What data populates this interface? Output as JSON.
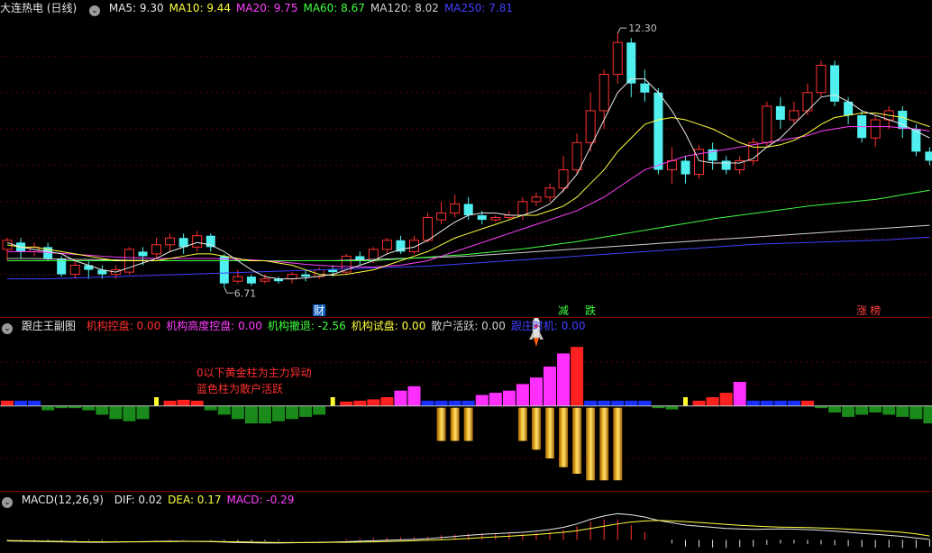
{
  "main": {
    "title": "大连热电 (日线)",
    "indicators": [
      {
        "label": "MA5:",
        "value": "9.30",
        "color": "#e8e8e8"
      },
      {
        "label": "MA10:",
        "value": "9.44",
        "color": "#ffff40"
      },
      {
        "label": "MA20:",
        "value": "9.75",
        "color": "#ff40ff"
      },
      {
        "label": "MA60:",
        "value": "8.67",
        "color": "#40ff40"
      },
      {
        "label": "MA120:",
        "value": "8.02",
        "color": "#d0d0d0"
      },
      {
        "label": "MA250:",
        "value": "7.81",
        "color": "#4040ff"
      }
    ],
    "high_label": "12.30",
    "low_label": "6.71",
    "markers": [
      {
        "text": "财",
        "index": 23,
        "color": "#ffffff",
        "bg": "#1060c0"
      },
      {
        "text": "减",
        "index": 41,
        "color": "#40ff40",
        "bg": ""
      },
      {
        "text": "跌",
        "index": 43,
        "color": "#40ff40",
        "bg": ""
      },
      {
        "text": "涨",
        "index": 63,
        "color": "#ff4040",
        "bg": ""
      },
      {
        "text": "榜",
        "index": 64,
        "color": "#ff4040",
        "bg": ""
      }
    ]
  },
  "sub1": {
    "title": "跟庄王副图",
    "indicators": [
      {
        "label": "机构控盘:",
        "value": "0.00",
        "color": "#ff3030"
      },
      {
        "label": "机构高度控盘:",
        "value": "0.00",
        "color": "#ff40ff"
      },
      {
        "label": "机构撤退:",
        "value": "-2.56",
        "color": "#40ff40"
      },
      {
        "label": "机构试盘:",
        "value": "0.00",
        "color": "#ffff40"
      },
      {
        "label": "散户活跃:",
        "value": "0.00",
        "color": "#d0d0d0"
      },
      {
        "label": "跟庄时机:",
        "value": "0.00",
        "color": "#4040ff"
      }
    ],
    "note_line1": "0以下黄金柱为主力异动",
    "note_line2": "蓝色柱为散户活跃"
  },
  "sub2": {
    "title": "MACD(12,26,9)",
    "indicators": [
      {
        "label": "DIF:",
        "value": "0.02",
        "color": "#e8e8e8"
      },
      {
        "label": "DEA:",
        "value": "0.17",
        "color": "#ffff40"
      },
      {
        "label": "MACD:",
        "value": "-0.29",
        "color": "#ff40ff"
      }
    ]
  },
  "colors": {
    "up": "#ff3030",
    "down": "#50f0f0",
    "ma5": "#e8e8e8",
    "ma10": "#ffff40",
    "ma20": "#ff40ff",
    "ma60": "#40ff40",
    "ma120": "#d0d0d0",
    "ma250": "#4040ff"
  },
  "chart_data": {
    "type": "candlestick",
    "y_range": [
      6.2,
      12.6
    ],
    "candles": [
      [
        7.55,
        7.75,
        7.3,
        7.8
      ],
      [
        7.7,
        7.5,
        7.35,
        7.8
      ],
      [
        7.5,
        7.6,
        7.4,
        7.7
      ],
      [
        7.6,
        7.35,
        7.3,
        7.7
      ],
      [
        7.35,
        7.0,
        6.95,
        7.4
      ],
      [
        7.0,
        7.2,
        6.9,
        7.3
      ],
      [
        7.2,
        7.1,
        6.9,
        7.3
      ],
      [
        7.1,
        7.0,
        6.9,
        7.2
      ],
      [
        7.0,
        7.1,
        6.9,
        7.2
      ],
      [
        7.05,
        7.55,
        7.0,
        7.6
      ],
      [
        7.5,
        7.4,
        7.2,
        7.6
      ],
      [
        7.45,
        7.65,
        7.35,
        7.8
      ],
      [
        7.65,
        7.8,
        7.5,
        7.9
      ],
      [
        7.8,
        7.6,
        7.45,
        7.9
      ],
      [
        7.6,
        7.85,
        7.5,
        7.95
      ],
      [
        7.85,
        7.6,
        7.5,
        7.9
      ],
      [
        7.4,
        6.8,
        6.71,
        7.45
      ],
      [
        6.85,
        6.95,
        6.8,
        7.1
      ],
      [
        6.95,
        6.8,
        6.75,
        7.0
      ],
      [
        6.85,
        6.9,
        6.8,
        7.0
      ],
      [
        6.9,
        6.85,
        6.8,
        6.95
      ],
      [
        6.9,
        7.0,
        6.8,
        7.05
      ],
      [
        7.0,
        6.95,
        6.85,
        7.1
      ],
      [
        6.95,
        7.1,
        6.9,
        7.15
      ],
      [
        7.1,
        7.05,
        6.95,
        7.2
      ],
      [
        7.05,
        7.4,
        7.0,
        7.45
      ],
      [
        7.4,
        7.3,
        7.2,
        7.5
      ],
      [
        7.3,
        7.55,
        7.25,
        7.6
      ],
      [
        7.55,
        7.75,
        7.45,
        7.8
      ],
      [
        7.75,
        7.5,
        7.45,
        7.85
      ],
      [
        7.5,
        7.75,
        7.45,
        7.85
      ],
      [
        7.75,
        8.25,
        7.7,
        8.35
      ],
      [
        8.2,
        8.35,
        8.1,
        8.6
      ],
      [
        8.35,
        8.55,
        8.25,
        8.75
      ],
      [
        8.55,
        8.3,
        8.2,
        8.7
      ],
      [
        8.3,
        8.2,
        8.1,
        8.4
      ],
      [
        8.2,
        8.25,
        8.15,
        8.3
      ],
      [
        8.25,
        8.3,
        8.2,
        8.4
      ],
      [
        8.3,
        8.6,
        8.2,
        8.7
      ],
      [
        8.6,
        8.7,
        8.5,
        8.8
      ],
      [
        8.7,
        8.9,
        8.6,
        9.0
      ],
      [
        8.9,
        9.3,
        8.8,
        9.6
      ],
      [
        9.3,
        9.9,
        9.2,
        10.1
      ],
      [
        9.9,
        10.6,
        9.7,
        11.0
      ],
      [
        10.6,
        11.4,
        10.2,
        11.5
      ],
      [
        11.4,
        12.1,
        11.2,
        12.3
      ],
      [
        12.1,
        11.2,
        10.9,
        12.2
      ],
      [
        11.2,
        11.0,
        10.8,
        11.5
      ],
      [
        11.0,
        9.3,
        9.2,
        11.1
      ],
      [
        9.3,
        9.5,
        9.0,
        9.8
      ],
      [
        9.5,
        9.2,
        9.0,
        9.6
      ],
      [
        9.2,
        9.75,
        9.1,
        9.85
      ],
      [
        9.75,
        9.5,
        9.3,
        9.9
      ],
      [
        9.5,
        9.3,
        9.2,
        9.6
      ],
      [
        9.3,
        9.5,
        9.2,
        9.6
      ],
      [
        9.5,
        9.9,
        9.4,
        10.0
      ],
      [
        9.9,
        10.7,
        9.8,
        10.8
      ],
      [
        10.7,
        10.4,
        10.2,
        10.9
      ],
      [
        10.4,
        10.6,
        10.3,
        10.8
      ],
      [
        10.6,
        11.0,
        10.5,
        11.2
      ],
      [
        11.0,
        11.6,
        10.9,
        11.7
      ],
      [
        11.6,
        10.8,
        10.7,
        11.7
      ],
      [
        10.8,
        10.5,
        10.3,
        10.9
      ],
      [
        10.5,
        10.0,
        9.9,
        10.6
      ],
      [
        10.0,
        10.4,
        9.8,
        10.5
      ],
      [
        10.4,
        10.6,
        10.2,
        10.7
      ],
      [
        10.6,
        10.2,
        10.0,
        10.7
      ],
      [
        10.2,
        9.7,
        9.6,
        10.3
      ],
      [
        9.7,
        9.5,
        9.4,
        9.8
      ]
    ],
    "ma_lines": {
      "ma5": [
        7.7,
        7.6,
        7.55,
        7.5,
        7.45,
        7.3,
        7.2,
        7.1,
        7.05,
        7.15,
        7.25,
        7.35,
        7.5,
        7.6,
        7.7,
        7.65,
        7.5,
        7.3,
        7.1,
        6.95,
        6.9,
        6.9,
        6.92,
        6.96,
        7.0,
        7.1,
        7.2,
        7.3,
        7.45,
        7.55,
        7.6,
        7.75,
        7.95,
        8.15,
        8.3,
        8.35,
        8.35,
        8.3,
        8.3,
        8.4,
        8.55,
        8.85,
        9.2,
        9.8,
        10.4,
        11.0,
        11.3,
        11.3,
        11.0,
        10.6,
        10.1,
        9.5,
        9.45,
        9.45,
        9.45,
        9.55,
        9.8,
        10.0,
        10.3,
        10.6,
        10.9,
        10.95,
        10.8,
        10.6,
        10.5,
        10.4,
        10.3,
        10.15,
        10.0
      ],
      "ma10": [
        7.65,
        7.6,
        7.6,
        7.55,
        7.5,
        7.45,
        7.4,
        7.35,
        7.3,
        7.3,
        7.3,
        7.3,
        7.35,
        7.4,
        7.45,
        7.45,
        7.4,
        7.35,
        7.3,
        7.3,
        7.25,
        7.2,
        7.1,
        7.0,
        6.98,
        7.0,
        7.05,
        7.1,
        7.2,
        7.3,
        7.4,
        7.5,
        7.65,
        7.8,
        7.9,
        8.0,
        8.1,
        8.2,
        8.3,
        8.3,
        8.4,
        8.5,
        8.7,
        9.0,
        9.3,
        9.7,
        10.0,
        10.3,
        10.4,
        10.45,
        10.4,
        10.3,
        10.2,
        10.05,
        9.9,
        9.8,
        9.8,
        9.85,
        9.95,
        10.1,
        10.3,
        10.45,
        10.5,
        10.55,
        10.55,
        10.5,
        10.45,
        10.35,
        10.25
      ],
      "ma20": [
        7.5,
        7.5,
        7.5,
        7.48,
        7.46,
        7.44,
        7.42,
        7.4,
        7.38,
        7.37,
        7.36,
        7.35,
        7.35,
        7.35,
        7.35,
        7.35,
        7.34,
        7.33,
        7.32,
        7.3,
        7.28,
        7.25,
        7.22,
        7.2,
        7.18,
        7.17,
        7.16,
        7.16,
        7.18,
        7.2,
        7.25,
        7.3,
        7.4,
        7.5,
        7.6,
        7.7,
        7.8,
        7.9,
        8.0,
        8.1,
        8.2,
        8.3,
        8.4,
        8.55,
        8.7,
        8.9,
        9.1,
        9.3,
        9.4,
        9.5,
        9.6,
        9.65,
        9.7,
        9.75,
        9.8,
        9.85,
        9.9,
        9.95,
        10.0,
        10.05,
        10.15,
        10.2,
        10.25,
        10.25,
        10.25,
        10.25,
        10.22,
        10.2,
        10.15
      ],
      "ma60": [
        7.3,
        7.3,
        7.3,
        7.3,
        7.3,
        7.3,
        7.3,
        7.3,
        7.3,
        7.3,
        7.3,
        7.3,
        7.3,
        7.3,
        7.3,
        7.3,
        7.3,
        7.3,
        7.3,
        7.3,
        7.3,
        7.3,
        7.3,
        7.3,
        7.3,
        7.3,
        7.3,
        7.3,
        7.32,
        7.34,
        7.36,
        7.38,
        7.4,
        7.42,
        7.44,
        7.47,
        7.5,
        7.53,
        7.56,
        7.6,
        7.64,
        7.68,
        7.72,
        7.77,
        7.82,
        7.87,
        7.92,
        7.97,
        8.02,
        8.07,
        8.12,
        8.17,
        8.22,
        8.26,
        8.3,
        8.34,
        8.38,
        8.42,
        8.46,
        8.5,
        8.53,
        8.56,
        8.59,
        8.62,
        8.65,
        8.7,
        8.75,
        8.8,
        8.85
      ],
      "ma120": [
        7.35,
        7.35,
        7.35,
        7.34,
        7.34,
        7.33,
        7.33,
        7.32,
        7.32,
        7.31,
        7.31,
        7.3,
        7.3,
        7.3,
        7.3,
        7.3,
        7.3,
        7.3,
        7.3,
        7.3,
        7.3,
        7.3,
        7.3,
        7.3,
        7.3,
        7.31,
        7.32,
        7.33,
        7.34,
        7.35,
        7.36,
        7.37,
        7.38,
        7.39,
        7.4,
        7.42,
        7.44,
        7.46,
        7.48,
        7.5,
        7.52,
        7.54,
        7.56,
        7.58,
        7.6,
        7.62,
        7.64,
        7.66,
        7.68,
        7.7,
        7.72,
        7.74,
        7.76,
        7.78,
        7.8,
        7.82,
        7.84,
        7.86,
        7.88,
        7.9,
        7.92,
        7.94,
        7.96,
        7.98,
        8.0,
        8.02,
        8.04,
        8.06,
        8.08
      ],
      "ma250": [
        6.9,
        6.9,
        6.9,
        6.9,
        6.91,
        6.92,
        6.93,
        6.94,
        6.95,
        6.96,
        6.97,
        6.98,
        6.99,
        7.0,
        7.01,
        7.02,
        7.03,
        7.04,
        7.05,
        7.06,
        7.07,
        7.08,
        7.09,
        7.1,
        7.11,
        7.12,
        7.13,
        7.14,
        7.15,
        7.16,
        7.17,
        7.18,
        7.2,
        7.22,
        7.24,
        7.26,
        7.28,
        7.3,
        7.32,
        7.34,
        7.36,
        7.38,
        7.4,
        7.42,
        7.44,
        7.46,
        7.48,
        7.5,
        7.52,
        7.54,
        7.56,
        7.58,
        7.6,
        7.62,
        7.64,
        7.66,
        7.67,
        7.68,
        7.69,
        7.7,
        7.71,
        7.72,
        7.73,
        7.74,
        7.75,
        7.76,
        7.78,
        7.8,
        7.82
      ]
    },
    "sub1_bars": [
      [
        "r",
        0.12
      ],
      [
        "b",
        0.12
      ],
      [
        "b",
        0.12
      ],
      [
        "g",
        -0.1
      ],
      [
        "g",
        -0.05
      ],
      [
        "g",
        -0.05
      ],
      [
        "g",
        -0.1
      ],
      [
        "g",
        -0.2
      ],
      [
        "g",
        -0.3
      ],
      [
        "g",
        -0.35
      ],
      [
        "g",
        -0.3
      ],
      [
        "y",
        0.2
      ],
      [
        "r",
        0.12
      ],
      [
        "r",
        0.14
      ],
      [
        "r",
        0.12
      ],
      [
        "g",
        -0.1
      ],
      [
        "g",
        -0.2
      ],
      [
        "g",
        -0.3
      ],
      [
        "g",
        -0.4
      ],
      [
        "g",
        -0.4
      ],
      [
        "g",
        -0.35
      ],
      [
        "g",
        -0.3
      ],
      [
        "g",
        -0.25
      ],
      [
        "g",
        -0.2
      ],
      [
        "y",
        0.2
      ],
      [
        "r",
        0.1
      ],
      [
        "r",
        0.12
      ],
      [
        "r",
        0.15
      ],
      [
        "r",
        0.2
      ],
      [
        "m",
        0.35
      ],
      [
        "m",
        0.45
      ],
      [
        "b",
        0.12
      ],
      [
        "b",
        0.12
      ],
      [
        "b",
        0.12
      ],
      [
        "b",
        0.12
      ],
      [
        "m",
        0.25
      ],
      [
        "m",
        0.3
      ],
      [
        "m",
        0.35
      ],
      [
        "m",
        0.5
      ],
      [
        "m",
        0.65
      ],
      [
        "m",
        0.9
      ],
      [
        "m",
        1.2
      ],
      [
        "r",
        1.35
      ],
      [
        "b",
        0.12
      ],
      [
        "b",
        0.12
      ],
      [
        "b",
        0.12
      ],
      [
        "b",
        0.12
      ],
      [
        "b",
        0.12
      ],
      [
        "g",
        -0.05
      ],
      [
        "g",
        -0.08
      ],
      [
        "y",
        0.2
      ],
      [
        "r",
        0.12
      ],
      [
        "r",
        0.2
      ],
      [
        "r",
        0.3
      ],
      [
        "m",
        0.55
      ],
      [
        "b",
        0.12
      ],
      [
        "b",
        0.12
      ],
      [
        "b",
        0.12
      ],
      [
        "b",
        0.12
      ],
      [
        "r",
        0.12
      ],
      [
        "g",
        -0.05
      ],
      [
        "g",
        -0.15
      ],
      [
        "g",
        -0.25
      ],
      [
        "g",
        -0.2
      ],
      [
        "g",
        -0.15
      ],
      [
        "g",
        -0.2
      ],
      [
        "g",
        -0.25
      ],
      [
        "g",
        -0.3
      ],
      [
        "g",
        -0.4
      ]
    ],
    "sub1_gold": [
      [
        32,
        -0.8
      ],
      [
        33,
        -0.8
      ],
      [
        34,
        -0.8
      ],
      [
        38,
        -0.8
      ],
      [
        39,
        -1.0
      ],
      [
        40,
        -1.2
      ],
      [
        41,
        -1.4
      ],
      [
        42,
        -1.55
      ],
      [
        43,
        -1.7
      ],
      [
        44,
        -1.7
      ],
      [
        45,
        -1.7
      ]
    ],
    "sub1_range": [
      -1.9,
      1.6
    ],
    "macd_dif": [
      -0.05,
      -0.06,
      -0.07,
      -0.08,
      -0.09,
      -0.1,
      -0.11,
      -0.11,
      -0.1,
      -0.09,
      -0.08,
      -0.07,
      -0.06,
      -0.06,
      -0.07,
      -0.08,
      -0.1,
      -0.12,
      -0.13,
      -0.14,
      -0.14,
      -0.13,
      -0.12,
      -0.11,
      -0.1,
      -0.08,
      -0.06,
      -0.04,
      -0.02,
      0.0,
      0.02,
      0.05,
      0.1,
      0.15,
      0.2,
      0.24,
      0.27,
      0.3,
      0.33,
      0.38,
      0.45,
      0.55,
      0.7,
      0.9,
      1.05,
      1.15,
      1.1,
      1.0,
      0.85,
      0.75,
      0.65,
      0.6,
      0.55,
      0.5,
      0.48,
      0.46,
      0.47,
      0.48,
      0.47,
      0.45,
      0.42,
      0.38,
      0.33,
      0.28,
      0.24,
      0.2,
      0.15,
      0.08,
      0.02
    ],
    "macd_dea": [
      -0.03,
      -0.04,
      -0.05,
      -0.06,
      -0.07,
      -0.08,
      -0.09,
      -0.09,
      -0.09,
      -0.09,
      -0.09,
      -0.08,
      -0.08,
      -0.07,
      -0.07,
      -0.07,
      -0.08,
      -0.09,
      -0.1,
      -0.11,
      -0.12,
      -0.12,
      -0.12,
      -0.12,
      -0.11,
      -0.11,
      -0.1,
      -0.09,
      -0.07,
      -0.06,
      -0.04,
      -0.02,
      0.0,
      0.03,
      0.06,
      0.1,
      0.13,
      0.16,
      0.2,
      0.23,
      0.28,
      0.33,
      0.4,
      0.5,
      0.6,
      0.7,
      0.78,
      0.83,
      0.85,
      0.83,
      0.8,
      0.76,
      0.72,
      0.68,
      0.64,
      0.61,
      0.58,
      0.56,
      0.55,
      0.54,
      0.52,
      0.5,
      0.47,
      0.44,
      0.41,
      0.37,
      0.33,
      0.26,
      0.17
    ],
    "macd_range": [
      -0.5,
      1.4
    ]
  }
}
